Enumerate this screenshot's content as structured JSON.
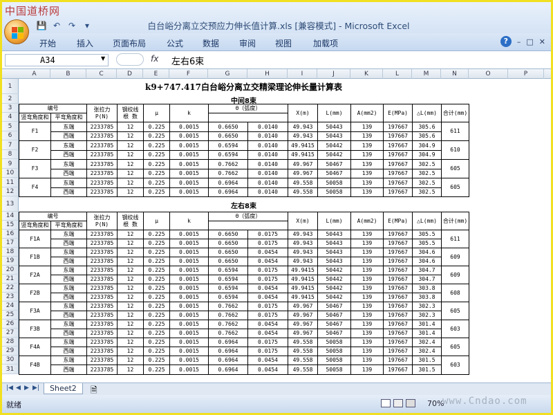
{
  "watermark": "中国道桥网",
  "window": {
    "title": "白台峪分离立交预应力伸长值计算.xls  [兼容模式] - Microsoft Excel"
  },
  "ribbon": {
    "tabs": [
      "开始",
      "插入",
      "页面布局",
      "公式",
      "数据",
      "审阅",
      "视图",
      "加载项"
    ],
    "help": "?"
  },
  "formula_bar": {
    "name_box": "A34",
    "fx": "fx",
    "content": "左右6束"
  },
  "columns": [
    "A",
    "B",
    "C",
    "D",
    "E",
    "F",
    "G",
    "H",
    "I",
    "J",
    "K",
    "L",
    "M",
    "N",
    "O",
    "P"
  ],
  "rows": [
    "1",
    "2",
    "3",
    "4",
    "5",
    "6",
    "7",
    "8",
    "9",
    "10",
    "11",
    "12",
    "13",
    "14",
    "15",
    "16",
    "17",
    "18",
    "19",
    "20",
    "21",
    "22",
    "23",
    "24",
    "25",
    "26",
    "27",
    "28",
    "29",
    "30",
    "31"
  ],
  "sheet": {
    "title": "k9+747.417白台峪分离立交精梁理论伸长量计算表",
    "section1": "中间8束",
    "section2": "左右8束",
    "headers": {
      "id": "编号",
      "p": "张拉力\nP(N)",
      "n": "钢绞线\n根 数",
      "mu": "μ",
      "k": "k",
      "theta": "θ（弧度）",
      "theta_v": "竖弯角度和",
      "theta_h": "平弯角度和",
      "x": "X(m)",
      "l": "L(mm)",
      "a": "A(mm2)",
      "e": "E(MPa)",
      "dl": "△L(mm)",
      "sum": "合计(mm)"
    },
    "middle": [
      {
        "id": "F1",
        "sum": "611",
        "rows": [
          {
            "side": "东端",
            "p": "2233785",
            "n": "12",
            "mu": "0.225",
            "k": "0.0015",
            "tv": "0.6650",
            "th": "0.0140",
            "x": "49.943",
            "l": "50443",
            "a": "139",
            "e": "197667",
            "dl": "305.6"
          },
          {
            "side": "西端",
            "p": "2233785",
            "n": "12",
            "mu": "0.225",
            "k": "0.0015",
            "tv": "0.6650",
            "th": "0.0140",
            "x": "49.943",
            "l": "50443",
            "a": "139",
            "e": "197667",
            "dl": "305.6"
          }
        ]
      },
      {
        "id": "F2",
        "sum": "610",
        "rows": [
          {
            "side": "东端",
            "p": "2233785",
            "n": "12",
            "mu": "0.225",
            "k": "0.0015",
            "tv": "0.6594",
            "th": "0.0140",
            "x": "49.9415",
            "l": "50442",
            "a": "139",
            "e": "197667",
            "dl": "304.9"
          },
          {
            "side": "西端",
            "p": "2233785",
            "n": "12",
            "mu": "0.225",
            "k": "0.0015",
            "tv": "0.6594",
            "th": "0.0140",
            "x": "49.9415",
            "l": "50442",
            "a": "139",
            "e": "197667",
            "dl": "304.9"
          }
        ]
      },
      {
        "id": "F3",
        "sum": "605",
        "rows": [
          {
            "side": "东端",
            "p": "2233785",
            "n": "12",
            "mu": "0.225",
            "k": "0.0015",
            "tv": "0.7662",
            "th": "0.0140",
            "x": "49.967",
            "l": "50467",
            "a": "139",
            "e": "197667",
            "dl": "302.5"
          },
          {
            "side": "西端",
            "p": "2233785",
            "n": "12",
            "mu": "0.225",
            "k": "0.0015",
            "tv": "0.7662",
            "th": "0.0140",
            "x": "49.967",
            "l": "50467",
            "a": "139",
            "e": "197667",
            "dl": "302.5"
          }
        ]
      },
      {
        "id": "F4",
        "sum": "605",
        "rows": [
          {
            "side": "东端",
            "p": "2233785",
            "n": "12",
            "mu": "0.225",
            "k": "0.0015",
            "tv": "0.6964",
            "th": "0.0140",
            "x": "49.558",
            "l": "50058",
            "a": "139",
            "e": "197667",
            "dl": "302.5"
          },
          {
            "side": "西端",
            "p": "2233785",
            "n": "12",
            "mu": "0.225",
            "k": "0.0015",
            "tv": "0.6964",
            "th": "0.0140",
            "x": "49.558",
            "l": "50058",
            "a": "139",
            "e": "197667",
            "dl": "302.5"
          }
        ]
      }
    ],
    "sides": [
      {
        "id": "F1A",
        "sum": "611",
        "rows": [
          {
            "side": "东端",
            "p": "2233785",
            "n": "12",
            "mu": "0.225",
            "k": "0.0015",
            "tv": "0.6650",
            "th": "0.0175",
            "x": "49.943",
            "l": "50443",
            "a": "139",
            "e": "197667",
            "dl": "305.5"
          },
          {
            "side": "西端",
            "p": "2233785",
            "n": "12",
            "mu": "0.225",
            "k": "0.0015",
            "tv": "0.6650",
            "th": "0.0175",
            "x": "49.943",
            "l": "50443",
            "a": "139",
            "e": "197667",
            "dl": "305.5"
          }
        ]
      },
      {
        "id": "F1B",
        "sum": "609",
        "rows": [
          {
            "side": "东端",
            "p": "2233785",
            "n": "12",
            "mu": "0.225",
            "k": "0.0015",
            "tv": "0.6650",
            "th": "0.0454",
            "x": "49.943",
            "l": "50443",
            "a": "139",
            "e": "197667",
            "dl": "304.6"
          },
          {
            "side": "西端",
            "p": "2233785",
            "n": "12",
            "mu": "0.225",
            "k": "0.0015",
            "tv": "0.6650",
            "th": "0.0454",
            "x": "49.943",
            "l": "50443",
            "a": "139",
            "e": "197667",
            "dl": "304.6"
          }
        ]
      },
      {
        "id": "F2A",
        "sum": "609",
        "rows": [
          {
            "side": "东端",
            "p": "2233785",
            "n": "12",
            "mu": "0.225",
            "k": "0.0015",
            "tv": "0.6594",
            "th": "0.0175",
            "x": "49.9415",
            "l": "50442",
            "a": "139",
            "e": "197667",
            "dl": "304.7"
          },
          {
            "side": "西端",
            "p": "2233785",
            "n": "12",
            "mu": "0.225",
            "k": "0.0015",
            "tv": "0.6594",
            "th": "0.0175",
            "x": "49.9415",
            "l": "50442",
            "a": "139",
            "e": "197667",
            "dl": "304.7"
          }
        ]
      },
      {
        "id": "F2B",
        "sum": "608",
        "rows": [
          {
            "side": "东端",
            "p": "2233785",
            "n": "12",
            "mu": "0.225",
            "k": "0.0015",
            "tv": "0.6594",
            "th": "0.0454",
            "x": "49.9415",
            "l": "50442",
            "a": "139",
            "e": "197667",
            "dl": "303.8"
          },
          {
            "side": "西端",
            "p": "2233785",
            "n": "12",
            "mu": "0.225",
            "k": "0.0015",
            "tv": "0.6594",
            "th": "0.0454",
            "x": "49.9415",
            "l": "50442",
            "a": "139",
            "e": "197667",
            "dl": "303.8"
          }
        ]
      },
      {
        "id": "F3A",
        "sum": "605",
        "rows": [
          {
            "side": "东端",
            "p": "2233785",
            "n": "12",
            "mu": "0.225",
            "k": "0.0015",
            "tv": "0.7662",
            "th": "0.0175",
            "x": "49.967",
            "l": "50467",
            "a": "139",
            "e": "197667",
            "dl": "302.3"
          },
          {
            "side": "西端",
            "p": "2233785",
            "n": "12",
            "mu": "0.225",
            "k": "0.0015",
            "tv": "0.7662",
            "th": "0.0175",
            "x": "49.967",
            "l": "50467",
            "a": "139",
            "e": "197667",
            "dl": "302.3"
          }
        ]
      },
      {
        "id": "F3B",
        "sum": "603",
        "rows": [
          {
            "side": "东端",
            "p": "2233785",
            "n": "12",
            "mu": "0.225",
            "k": "0.0015",
            "tv": "0.7662",
            "th": "0.0454",
            "x": "49.967",
            "l": "50467",
            "a": "139",
            "e": "197667",
            "dl": "301.4"
          },
          {
            "side": "西端",
            "p": "2233785",
            "n": "12",
            "mu": "0.225",
            "k": "0.0015",
            "tv": "0.7662",
            "th": "0.0454",
            "x": "49.967",
            "l": "50467",
            "a": "139",
            "e": "197667",
            "dl": "301.4"
          }
        ]
      },
      {
        "id": "F4A",
        "sum": "605",
        "rows": [
          {
            "side": "东端",
            "p": "2233785",
            "n": "12",
            "mu": "0.225",
            "k": "0.0015",
            "tv": "0.6964",
            "th": "0.0175",
            "x": "49.558",
            "l": "50058",
            "a": "139",
            "e": "197667",
            "dl": "302.4"
          },
          {
            "side": "西端",
            "p": "2233785",
            "n": "12",
            "mu": "0.225",
            "k": "0.0015",
            "tv": "0.6964",
            "th": "0.0175",
            "x": "49.558",
            "l": "50058",
            "a": "139",
            "e": "197667",
            "dl": "302.4"
          }
        ]
      },
      {
        "id": "F4B",
        "sum": "603",
        "rows": [
          {
            "side": "东端",
            "p": "2233785",
            "n": "12",
            "mu": "0.225",
            "k": "0.0015",
            "tv": "0.6964",
            "th": "0.0454",
            "x": "49.558",
            "l": "50058",
            "a": "139",
            "e": "197667",
            "dl": "301.5"
          },
          {
            "side": "西端",
            "p": "2233785",
            "n": "12",
            "mu": "0.225",
            "k": "0.0015",
            "tv": "0.6964",
            "th": "0.0454",
            "x": "49.558",
            "l": "50058",
            "a": "139",
            "e": "197667",
            "dl": "301.5"
          }
        ]
      }
    ]
  },
  "sheet_tabs": {
    "active": "Sheet2"
  },
  "status": {
    "text": "就绪",
    "zoom": "70%",
    "site": "www.Cndao.com"
  }
}
